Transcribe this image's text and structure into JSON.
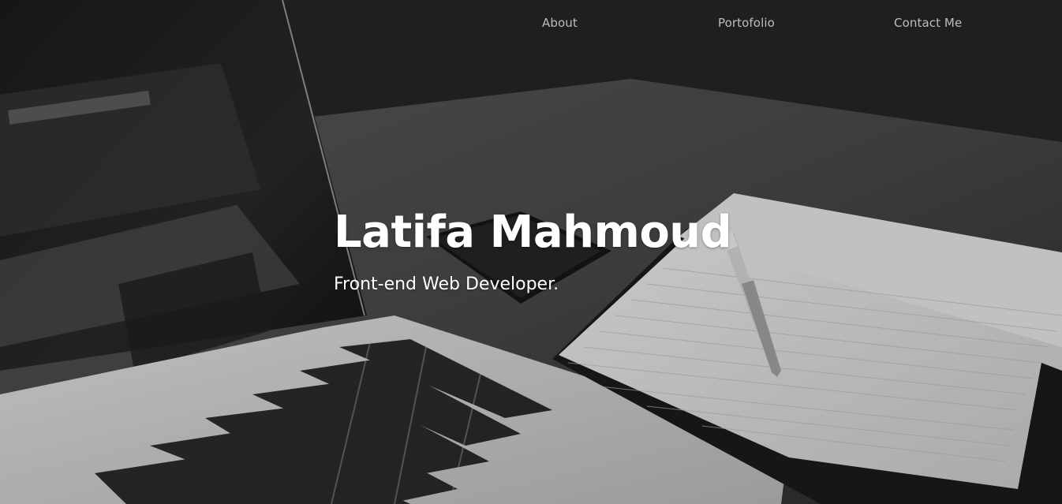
{
  "nav": {
    "items": [
      {
        "label": "About"
      },
      {
        "label": "Portofolio"
      },
      {
        "label": "Contact Me"
      }
    ]
  },
  "hero": {
    "title": "Latifa Mahmoud",
    "subtitle": "Front-end Web Developer.",
    "background_image": "grayscale-desk-laptop-notebook-pen-phone"
  },
  "colors": {
    "nav_text": "#bdbdbd",
    "hero_text": "#ffffff"
  }
}
